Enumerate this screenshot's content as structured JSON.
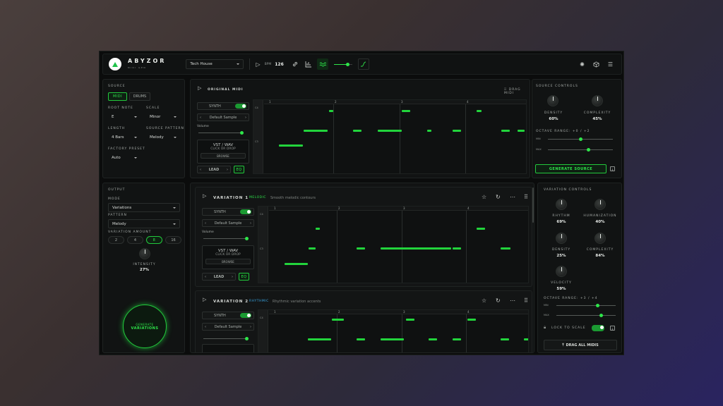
{
  "header": {
    "brand": "ABYZOR",
    "brand_sub": "MIDI GEN",
    "genre": "Tech House",
    "bpm_label": "BPM",
    "bpm": "126"
  },
  "source": {
    "title": "SOURCE",
    "tab_midi": "MIDI",
    "tab_drums": "DRUMS",
    "root_label": "ROOT NOTE",
    "root": "E",
    "scale_label": "SCALE",
    "scale": "Minor",
    "length_label": "LENGTH",
    "length": "4 Bars",
    "pattern_label": "SOURCE PATTERN",
    "pattern": "Melody",
    "preset_label": "FACTORY PRESET",
    "preset": "Auto"
  },
  "output": {
    "title": "OUTPUT",
    "mode_label": "MODE",
    "mode": "Variations",
    "pattern_label": "PATTERN",
    "pattern": "Melody",
    "amount_label": "VARIATION AMOUNT",
    "amounts": [
      "2",
      "4",
      "8",
      "16"
    ],
    "intensity_label": "INTENSITY",
    "intensity": "27%",
    "generate": "GENERATE",
    "generate2": "VARIATIONS"
  },
  "original": {
    "title": "ORIGINAL MIDI",
    "drag": "DRAG MIDI",
    "bars": [
      "1",
      "2",
      "3",
      "4"
    ],
    "c4": "C4",
    "c3": "C3"
  },
  "instrument": {
    "synth": "SYNTH",
    "sample": "Default Sample",
    "volume": "Volume",
    "drop_title": "VST / WAV",
    "drop_sub": "CLICK OR DROP",
    "browse": "BROWSE",
    "lead": "LEAD",
    "eq": "EQ"
  },
  "source_controls": {
    "title": "SOURCE CONTROLS",
    "density_label": "DENSITY",
    "density": "60%",
    "complexity_label": "COMPLEXITY",
    "complexity": "45%",
    "octave": "OCTAVE RANGE: +0 / +2",
    "min": "MIN",
    "max": "MAX",
    "generate": "GENERATE SOURCE"
  },
  "variations": [
    {
      "title": "VARIATION 1",
      "tag": "MELODIC",
      "desc": "Smooth melodic contours"
    },
    {
      "title": "VARIATION 2",
      "tag": "RHYTHMIC",
      "desc": "Rhythmic variation accents"
    }
  ],
  "variation_controls": {
    "title": "VARIATION CONTROLS",
    "rhythm_label": "RHYTHM",
    "rhythm": "69%",
    "humanization_label": "HUMANIZATION",
    "humanization": "40%",
    "density_label": "DENSITY",
    "density": "25%",
    "complexity_label": "COMPLEXITY",
    "complexity": "84%",
    "velocity_label": "VELOCITY",
    "velocity": "59%",
    "octave": "OCTAVE RANGE: +3 / +4",
    "min": "MIN",
    "max": "MAX",
    "lock": "LOCK TO SCALE",
    "drag_all": "DRAG ALL MIDIS"
  },
  "colors": {
    "accent": "#22d43c"
  }
}
